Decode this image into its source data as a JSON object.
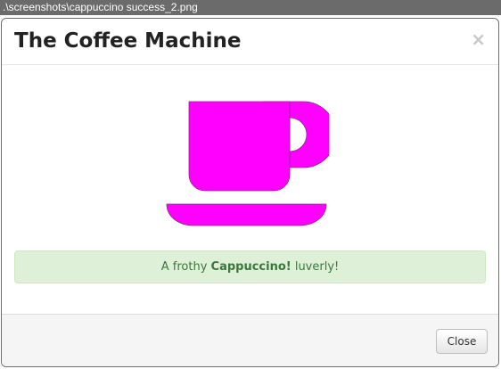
{
  "window": {
    "title": ".\\screenshots\\cappuccino success_2.png"
  },
  "modal": {
    "title": "The Coffee Machine",
    "close_glyph": "×",
    "icon": "coffee-cup-icon",
    "alert": {
      "prefix": "A frothy ",
      "drink": "Cappuccino!",
      "suffix": " luverly!"
    },
    "footer": {
      "close_label": "Close"
    }
  },
  "colors": {
    "cup_fill": "#ff00ff",
    "alert_bg": "#dff0d8",
    "alert_text": "#3c763d"
  }
}
